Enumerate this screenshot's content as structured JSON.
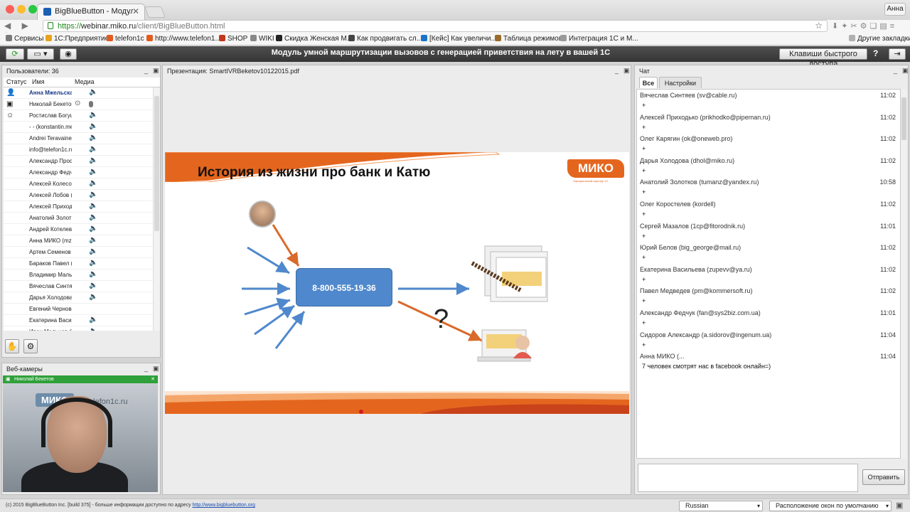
{
  "browser": {
    "tab_title": "BigBlueButton - Модуль умной маршрутизации",
    "tab_close": "✕",
    "user": "Анна",
    "nav": "◀ ▶ ↻",
    "url_scheme": "https://",
    "url_host": "webinar.miko.ru",
    "url_path": "/client/BigBlueButton.html",
    "bookmarks": [
      {
        "label": "Сервисы",
        "color": "#7a7a7a"
      },
      {
        "label": "1С:Предприятие",
        "color": "#e8a21c"
      },
      {
        "label": "telefon1c",
        "color": "#e45b1e"
      },
      {
        "label": "http://www.telefon1...",
        "color": "#e45b1e"
      },
      {
        "label": "SHOP",
        "color": "#c2361b"
      },
      {
        "label": "WIKI",
        "color": "#888888"
      },
      {
        "label": "Скидка Женская М...",
        "color": "#222222"
      },
      {
        "label": "Как продвигать сл...",
        "color": "#444444"
      },
      {
        "label": "[Кейс] Как увеличи...",
        "color": "#1a73c8"
      },
      {
        "label": "Таблица режимов",
        "color": "#9a6b2a"
      },
      {
        "label": "Интеграция 1С и М...",
        "color": "#9a9a9a"
      }
    ],
    "other_bookmarks": "Другие закладки"
  },
  "app": {
    "title": "Модуль умной маршрутизации вызовов с генерацией приветствия на лету в вашей 1С",
    "hotkeys_button": "Клавиши быстрого доступа",
    "help_button": "?",
    "logout_button": "⇥"
  },
  "users_panel": {
    "title": "Пользователи: 36",
    "col_status": "Статус",
    "col_name": "Имя",
    "col_media": "Медиа",
    "users": [
      {
        "name": "Анна Мжельская",
        "status": "👤",
        "highlight": true
      },
      {
        "name": "Николай Бекетов",
        "status": "▣",
        "cam": true
      },
      {
        "name": "Ростислав Богуш",
        "status": "☺"
      },
      {
        "name": "- - (konstantin.mel"
      },
      {
        "name": "Andrei Teravainen"
      },
      {
        "name": "info@telefon1c.ru"
      },
      {
        "name": "Александр Прост"
      },
      {
        "name": "Александр Федчук"
      },
      {
        "name": "Алексей Колесов"
      },
      {
        "name": "Алексей Лобов (L"
      },
      {
        "name": "Алексей Приходь"
      },
      {
        "name": "Анатолий Золотк"
      },
      {
        "name": "Андрей Котелевск"
      },
      {
        "name": "Анна МИКО (mzh"
      },
      {
        "name": "Артем Семенов ("
      },
      {
        "name": "Бараков Павел (p"
      },
      {
        "name": "Владимир Мальц"
      },
      {
        "name": "Вячеслав Синтяе"
      },
      {
        "name": "Дарья Холодова ("
      },
      {
        "name": "Евгений Чернов (",
        "nomedia": true
      },
      {
        "name": "Екатерина Васил"
      },
      {
        "name": "Иван Мальцев (iv"
      }
    ]
  },
  "webcams_panel": {
    "title": "Веб-камеры",
    "cam_user": "Николай Бекетов",
    "cam_logo": "МИКО",
    "cam_site": "telefon1c.ru"
  },
  "presentation_panel": {
    "title": "Презентация: SmartIVRBeketov10122015.pdf",
    "slide_title": "История из жизни про банк и Катю",
    "logo": "МИКО",
    "logo_sub": "Официальный партнер 1С",
    "phone": "8-800-555-19-36",
    "question": "?"
  },
  "chat_panel": {
    "title": "Чат",
    "tab_all": "Все",
    "tab_settings": "Настройки",
    "send": "Отправить",
    "messages": [
      {
        "who": "Вячеслав Синтяев (sv@cable.ru)",
        "time": "11:02",
        "text": "+"
      },
      {
        "who": "Алексей Приходько (prikhodko@pipeman.ru)",
        "time": "11:02",
        "text": "+"
      },
      {
        "who": "Олег Карягин (ok@oneweb.pro)",
        "time": "11:02",
        "text": "+"
      },
      {
        "who": "Дарья Холодова (dhol@miko.ru)",
        "time": "11:02",
        "text": "+"
      },
      {
        "who": "Анатолий Золотков (tumanz@yandex.ru)",
        "time": "10:58",
        "text": "+"
      },
      {
        "who": "Олег Коростелев (kordell)",
        "time": "11:02",
        "text": "+"
      },
      {
        "who": "Сергей Мазалов (1cp@fitorodnik.ru)",
        "time": "11:01",
        "text": "+"
      },
      {
        "who": "Юрий Белов (big_george@mail.ru)",
        "time": "11:02",
        "text": "+"
      },
      {
        "who": "Екатерина Васильева (zupevv@ya.ru)",
        "time": "11:02",
        "text": "+"
      },
      {
        "who": "Павел Медведев (pm@kommersoft.ru)",
        "time": "11:02",
        "text": "+"
      },
      {
        "who": "Александр Федчук (fan@sys2biz.com.ua)",
        "time": "11:01",
        "text": "+"
      },
      {
        "who": "Сидоров Александр (a.sidorov@ingenum.ua)",
        "time": "11:04",
        "text": "+"
      },
      {
        "who": "Анна МИКО (...",
        "time": "11:04",
        "text": "7 человек смотрят нас в facebook онлайн=)"
      }
    ]
  },
  "footer": {
    "copyright": "(c) 2015 BigBlueButton Inc. [build 375] - больше информации доступно по адресу",
    "link": "http://www.bigbluebutton.org",
    "language": "Russian",
    "layout": "Расположение окон по умолчанию"
  },
  "colors": {
    "accent": "#e4661e",
    "phone_box": "#4f88cc",
    "cam_bar": "#2fa03a"
  }
}
